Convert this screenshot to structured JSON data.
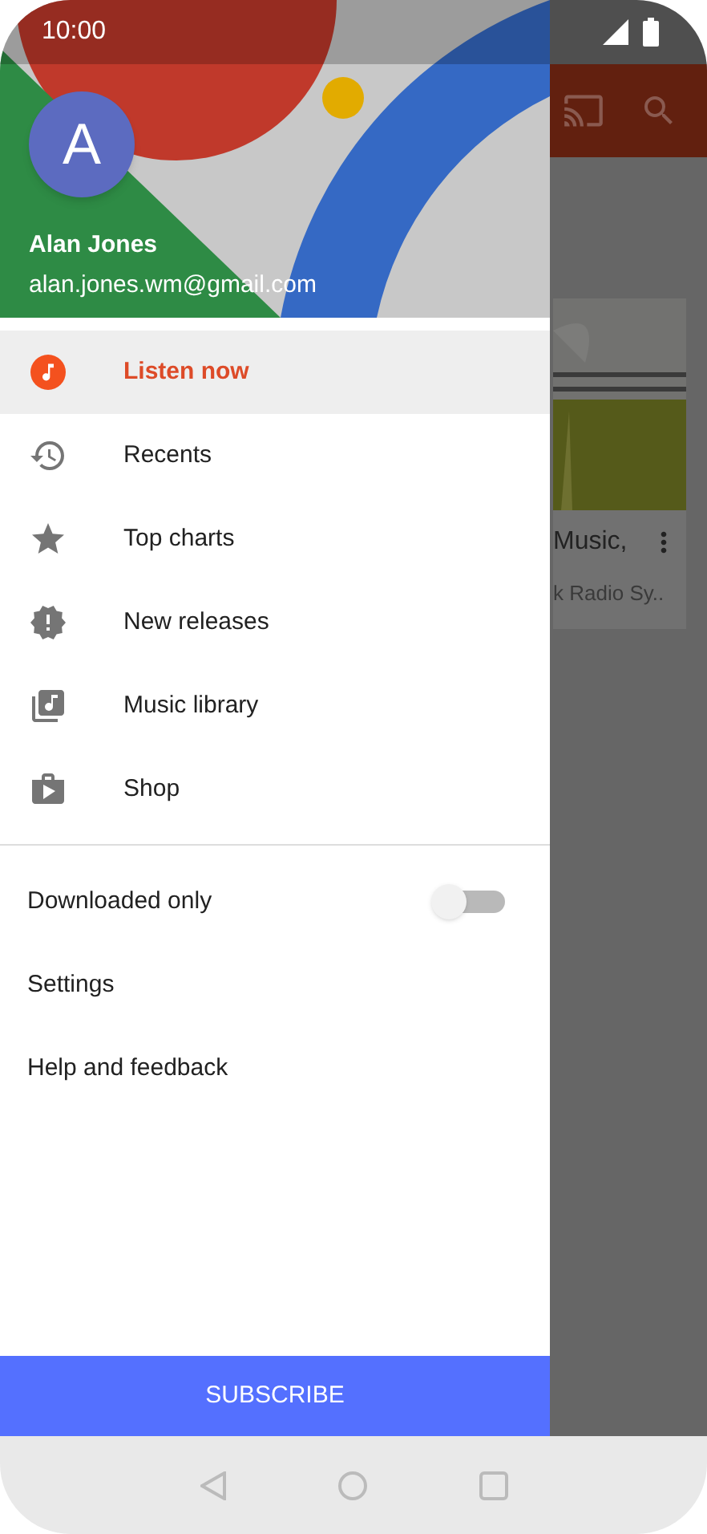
{
  "status_bar": {
    "time": "10:00"
  },
  "account": {
    "initial": "A",
    "name": "Alan Jones",
    "email": "alan.jones.wm@gmail.com"
  },
  "nav_items": [
    {
      "label": "Listen now",
      "selected": true,
      "kind": "listen"
    },
    {
      "label": "Recents",
      "selected": false,
      "kind": "recents"
    },
    {
      "label": "Top charts",
      "selected": false,
      "kind": "charts"
    },
    {
      "label": "New releases",
      "selected": false,
      "kind": "releases"
    },
    {
      "label": "Music library",
      "selected": false,
      "kind": "library"
    },
    {
      "label": "Shop",
      "selected": false,
      "kind": "shop"
    }
  ],
  "downloaded_only": {
    "label": "Downloaded only",
    "on": false
  },
  "links": [
    "Settings",
    "Help and feedback"
  ],
  "subscribe_button": "SUBSCRIBE",
  "background_card": {
    "title": "Music,",
    "subtitle": "k Radio Sy.."
  }
}
